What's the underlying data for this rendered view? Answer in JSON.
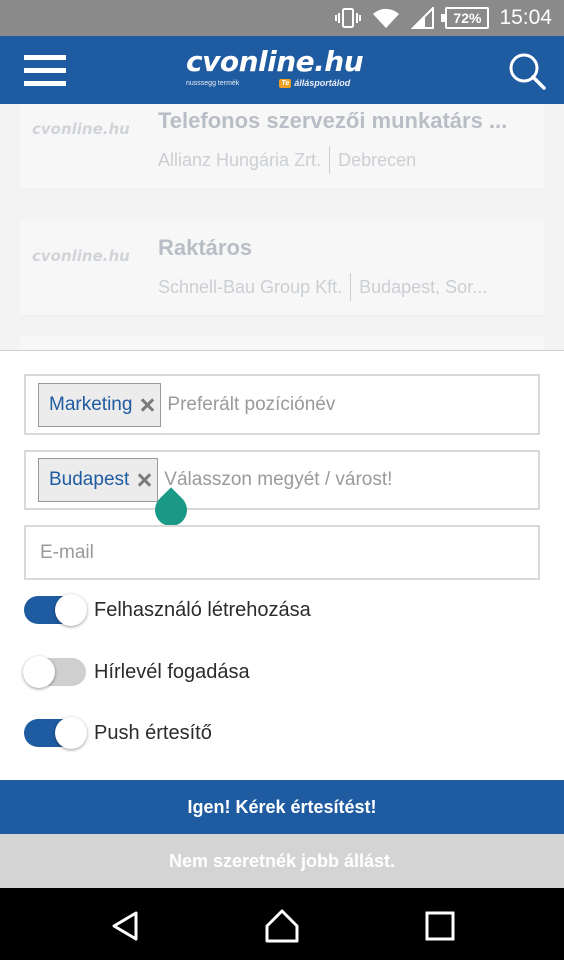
{
  "status_bar": {
    "battery": "72%",
    "time": "15:04"
  },
  "header": {
    "logo_text": "cvonline.hu",
    "logo_sub_small": "nusssegg termék",
    "logo_tag": "Te",
    "logo_tag_text": "állásportálod"
  },
  "jobs": [
    {
      "logo": "cvonline.hu",
      "title": "Telefonos szervezői munkatárs ...",
      "company": "Allianz Hungária Zrt.",
      "location": "Debrecen"
    },
    {
      "logo": "cvonline.hu",
      "title": "Raktáros",
      "company": "Schnell-Bau Group Kft.",
      "location": "Budapest, Sor..."
    }
  ],
  "form": {
    "position": {
      "chip": "Marketing",
      "placeholder": "Preferált pozíciónév"
    },
    "location": {
      "chip": "Budapest",
      "placeholder": "Válasszon megyét / várost!"
    },
    "email": {
      "placeholder": "E-mail",
      "value": ""
    },
    "toggles": [
      {
        "label": "Felhasználó létrehozása",
        "state": "on"
      },
      {
        "label": "Hírlevél fogadása",
        "state": "off"
      },
      {
        "label": "Push értesítő",
        "state": "on"
      }
    ]
  },
  "buttons": {
    "primary": "Igen! Kérek értesítést!",
    "secondary": "Nem szeretnék jobb állást."
  },
  "colors": {
    "brand_blue": "#1f5ba0",
    "accent_teal": "#1a9a86",
    "secondary_gray": "#d4d4d4"
  }
}
